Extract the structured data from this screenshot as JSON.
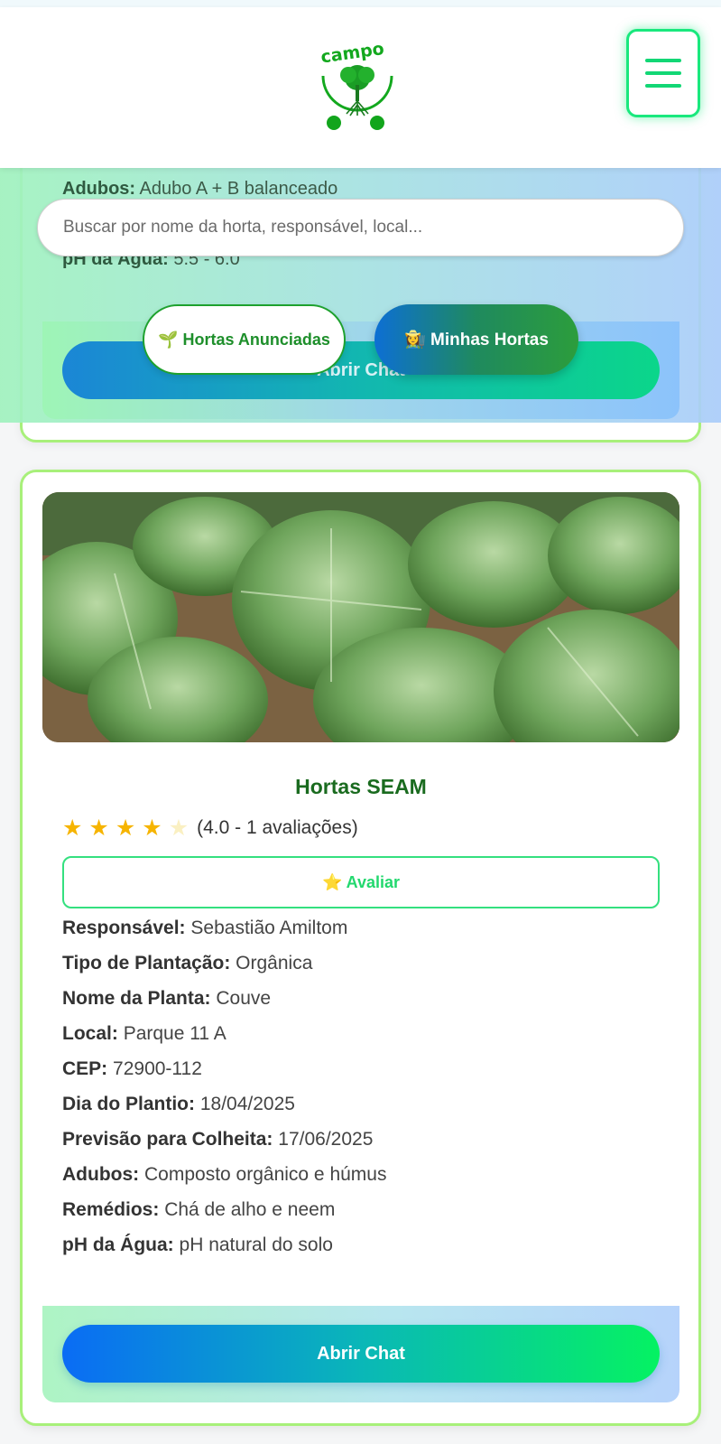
{
  "header": {
    "logo_text": "campo",
    "menu_icon": "hamburger-menu-icon"
  },
  "previous_card": {
    "adubos_label": "Adubos:",
    "adubos_value": "Adubo A + B balanceado",
    "ph_label": "pH da Água:",
    "ph_value": "5.5 - 6.0",
    "chat_label": "Abrir Chat"
  },
  "search": {
    "placeholder": "Buscar por nome da horta, responsável, local..."
  },
  "filters": {
    "anunciadas_label": "🌱 Hortas Anunciadas",
    "minhas_label": "👩‍🌾 Minhas Hortas"
  },
  "card": {
    "image_icon": "cabbage-photo",
    "title": "Hortas SEAM",
    "rating_value": 4.0,
    "rating_text": "(4.0 - 1 avaliações)",
    "avaliar_label": "⭐ Avaliar",
    "info": [
      {
        "label": "Responsável:",
        "value": "Sebastião Amiltom"
      },
      {
        "label": "Tipo de Plantação:",
        "value": "Orgânica"
      },
      {
        "label": "Nome da Planta:",
        "value": "Couve"
      },
      {
        "label": "Local:",
        "value": "Parque 11 A"
      },
      {
        "label": "CEP:",
        "value": "72900-112"
      },
      {
        "label": "Dia do Plantio:",
        "value": "18/04/2025"
      },
      {
        "label": "Previsão para Colheita:",
        "value": "17/06/2025"
      },
      {
        "label": "Adubos:",
        "value": "Composto orgânico e húmus"
      },
      {
        "label": "Remédios:",
        "value": "Chá de alho e neem"
      },
      {
        "label": "pH da Água:",
        "value": "pH natural do solo"
      }
    ],
    "chat_label": "Abrir Chat"
  },
  "colors": {
    "accent_green": "#19e87d",
    "title_green": "#1a6b1f",
    "star_gold": "#f6b400"
  }
}
